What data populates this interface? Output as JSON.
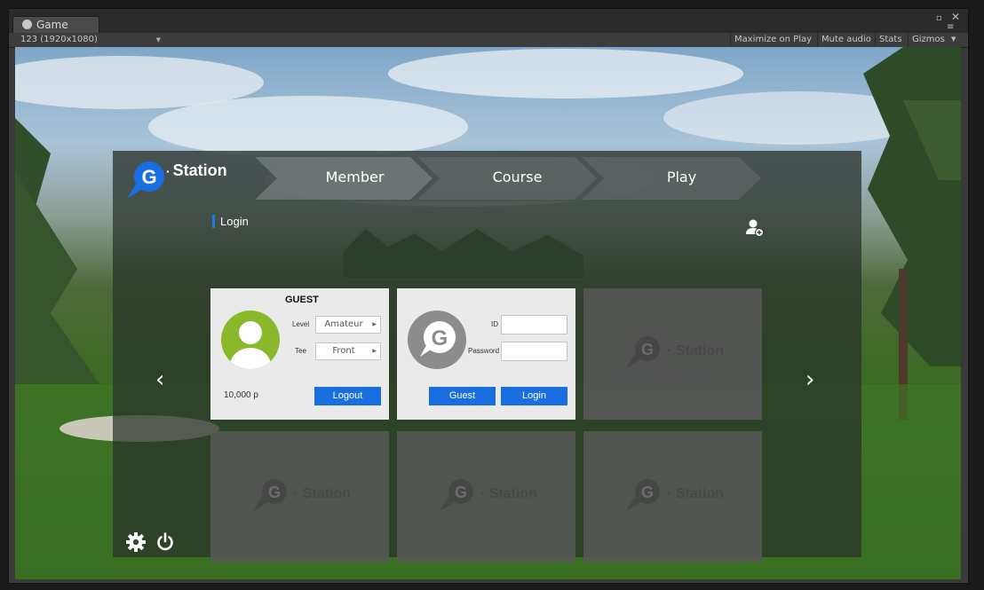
{
  "editor": {
    "tab_label": "Game",
    "resolution": "123 (1920x1080)",
    "maximize_on_play": "Maximize on Play",
    "mute_audio": "Mute audio",
    "stats": "Stats",
    "gizmos": "Gizmos"
  },
  "app": {
    "brand": "Station",
    "steps": [
      "Member",
      "Course",
      "Play"
    ],
    "section_label": "Login",
    "accent": "#1a6fe0"
  },
  "guest_card": {
    "name": "GUEST",
    "level_label": "Level",
    "level_value": "Amateur",
    "tee_label": "Tee",
    "tee_value": "Front",
    "points": "10,000 p",
    "logout_label": "Logout"
  },
  "login_card": {
    "id_label": "ID",
    "password_label": "Password",
    "guest_button": "Guest",
    "login_button": "Login"
  },
  "placeholder_slots": [
    {
      "brand": "Station"
    },
    {
      "brand": "Station"
    },
    {
      "brand": "Station"
    },
    {
      "brand": "Station"
    }
  ],
  "icons": {
    "nav_prev": "chevron-left-icon",
    "nav_next": "chevron-right-icon",
    "add_user": "add-user-icon",
    "settings": "gear-icon",
    "power": "power-icon"
  }
}
